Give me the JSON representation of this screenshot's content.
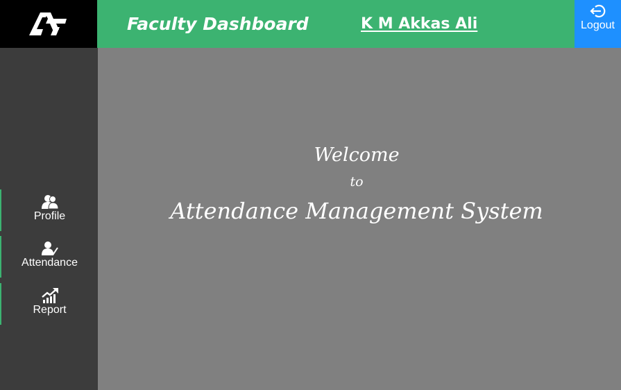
{
  "logo": {
    "icon": "brand-logo-icon"
  },
  "header": {
    "title": "Faculty Dashboard",
    "user_name": "K M Akkas Ali",
    "logout_label": "Logout",
    "logout_icon": "logout-icon"
  },
  "sidebar": {
    "items": [
      {
        "label": "Profile",
        "icon": "users-icon"
      },
      {
        "label": "Attendance",
        "icon": "user-check-icon"
      },
      {
        "label": "Report",
        "icon": "chart-growth-icon"
      }
    ]
  },
  "main": {
    "welcome_line": "Welcome",
    "to_line": "to",
    "system_name": "Attendance Management System"
  },
  "colors": {
    "header_green": "#3cb371",
    "logout_blue": "#1e90ff",
    "sidebar_bg": "#3c3c3c",
    "main_bg": "#808080"
  }
}
